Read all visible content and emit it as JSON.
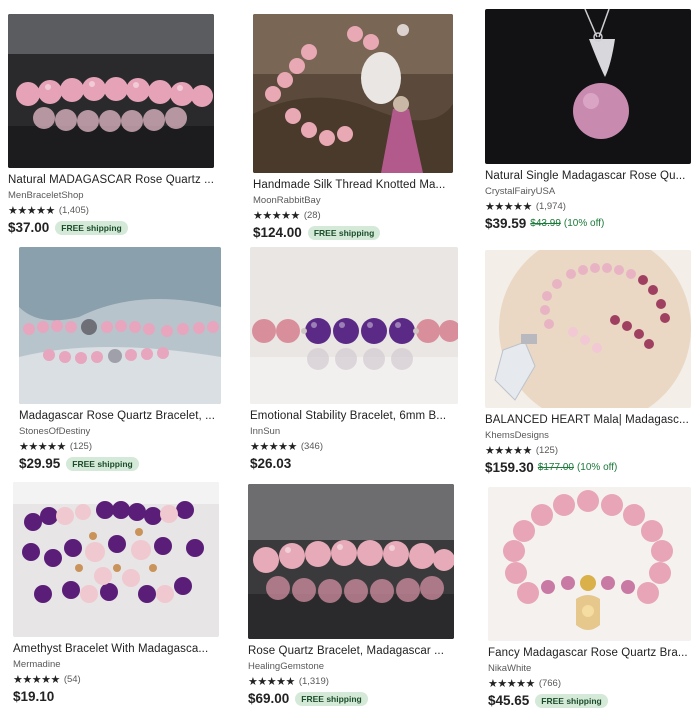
{
  "colors": {
    "rating_stars": "#222222",
    "free_shipping_badge_bg": "#d4e9d7",
    "discount_text": "#1d7a3a"
  },
  "listings": [
    {
      "title": "Natural MADAGASCAR Rose Quartz ...",
      "shop": "MenBraceletShop",
      "stars": "★★★★★",
      "reviews": "(1,405)",
      "price": "$37.00",
      "shipping": "FREE shipping"
    },
    {
      "title": "Handmade Silk Thread Knotted Ma...",
      "shop": "MoonRabbitBay",
      "stars": "★★★★★",
      "reviews": "(28)",
      "price": "$124.00",
      "shipping": "FREE shipping"
    },
    {
      "title": "Natural Single Madagascar Rose Qu...",
      "shop": "CrystalFairyUSA",
      "stars": "★★★★★",
      "reviews": "(1,974)",
      "price": "$39.59",
      "original_price": "$43.99",
      "discount": "(10% off)"
    },
    {
      "title": "Madagascar Rose Quartz Bracelet, ...",
      "shop": "StonesOfDestiny",
      "stars": "★★★★★",
      "reviews": "(125)",
      "price": "$29.95",
      "shipping": "FREE shipping"
    },
    {
      "title": "Emotional Stability Bracelet, 6mm B...",
      "shop": "InnSun",
      "stars": "★★★★★",
      "reviews": "(346)",
      "price": "$26.03"
    },
    {
      "title": "BALANCED HEART Mala| Madagasc...",
      "shop": "KhemsDesigns",
      "stars": "★★★★★",
      "reviews": "(125)",
      "price": "$159.30",
      "original_price": "$177.00",
      "discount": "(10% off)"
    },
    {
      "title": "Amethyst Bracelet With Madagasca...",
      "shop": "Mermadine",
      "stars": "★★★★★",
      "reviews": "(54)",
      "price": "$19.10"
    },
    {
      "title": "Rose Quartz Bracelet, Madagascar ...",
      "shop": "HealingGemstone",
      "stars": "★★★★★",
      "reviews": "(1,319)",
      "price": "$69.00",
      "shipping": "FREE shipping"
    },
    {
      "title": "Fancy Madagascar Rose Quartz Bra...",
      "shop": "NikaWhite",
      "stars": "★★★★★",
      "reviews": "(766)",
      "price": "$45.65",
      "shipping": "FREE shipping"
    }
  ]
}
